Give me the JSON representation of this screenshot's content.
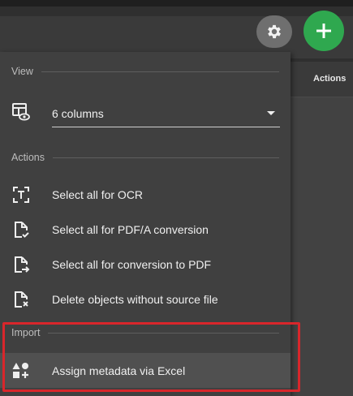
{
  "toolbar": {
    "settings_icon": "gear-icon",
    "add_icon": "plus-icon",
    "add_color": "#2fa84f"
  },
  "table": {
    "actions_header": "Actions"
  },
  "menu": {
    "view": {
      "heading": "View",
      "columns_icon": "table-eye-icon",
      "columns_value": "6 columns"
    },
    "actions": {
      "heading": "Actions",
      "items": [
        {
          "label": "Select all for OCR",
          "icon": "ocr-text-icon"
        },
        {
          "label": "Select all for PDF/A conversion",
          "icon": "file-check-icon"
        },
        {
          "label": "Select all for conversion to PDF",
          "icon": "file-arrow-icon"
        },
        {
          "label": "Delete objects without source file",
          "icon": "file-x-icon"
        }
      ]
    },
    "import": {
      "heading": "Import",
      "items": [
        {
          "label": "Assign metadata via Excel",
          "icon": "shapes-add-icon"
        }
      ]
    }
  },
  "annotation": {
    "highlight_color": "#d9262b"
  }
}
